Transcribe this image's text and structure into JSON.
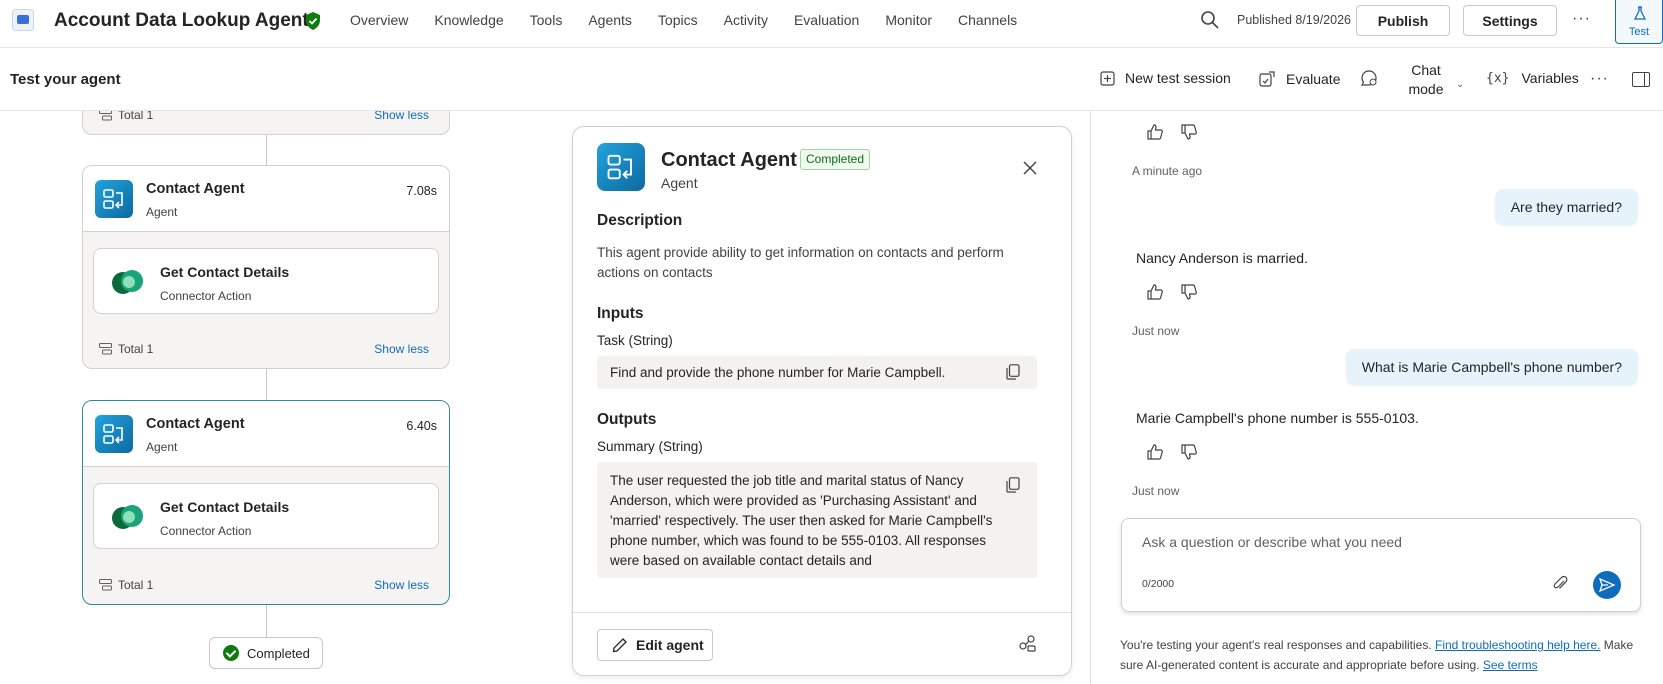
{
  "header": {
    "agent_title": "Account Data Lookup Agent",
    "nav": [
      "Overview",
      "Knowledge",
      "Tools",
      "Agents",
      "Topics",
      "Activity",
      "Evaluation",
      "Monitor",
      "Channels"
    ],
    "published": "Published 8/19/2026",
    "publish_label": "Publish",
    "settings_label": "Settings",
    "more_label": "···",
    "test_tab_label": "Test"
  },
  "subbar": {
    "title": "Test your agent",
    "new_session_label": "New test session",
    "evaluate_label": "Evaluate",
    "chat_mode_line1": "Chat",
    "chat_mode_line2": "mode",
    "variables_label": "Variables",
    "more_label": "···"
  },
  "canvas": {
    "top_partial": {
      "total": "Total 1",
      "show_less": "Show less"
    },
    "cards": [
      {
        "title": "Contact Agent",
        "subtitle": "Agent",
        "time": "7.08s",
        "action_title": "Get Contact Details",
        "action_subtitle": "Connector Action",
        "total": "Total 1",
        "show_less": "Show less"
      },
      {
        "title": "Contact Agent",
        "subtitle": "Agent",
        "time": "6.40s",
        "action_title": "Get Contact Details",
        "action_subtitle": "Connector Action",
        "total": "Total 1",
        "show_less": "Show less"
      }
    ],
    "completed_label": "Completed"
  },
  "detail": {
    "title": "Contact Agent",
    "badge": "Completed",
    "subtitle": "Agent",
    "description_heading": "Description",
    "description": "This agent provide ability to get information on contacts and perform actions on contacts",
    "inputs_heading": "Inputs",
    "input_label": "Task (String)",
    "input_value": "Find and provide the phone number for Marie Campbell.",
    "outputs_heading": "Outputs",
    "output_label": "Summary (String)",
    "output_value": "The user requested the job title and marital status of Nancy Anderson, which were provided as 'Purchasing Assistant' and 'married' respectively. The user then asked for Marie Campbell's phone number, which was found to be 555-0103. All responses were based on available contact details and",
    "output_partial_line": "...",
    "edit_label": "Edit agent"
  },
  "chat": {
    "ts1": "A minute ago",
    "user1": "Are they married?",
    "bot1": "Nancy Anderson is married.",
    "ts2": "Just now",
    "user2": "What is Marie Campbell's phone number?",
    "bot2": "Marie Campbell's phone number is 555-0103.",
    "ts3": "Just now",
    "input_placeholder": "Ask a question or describe what you need",
    "counter": "0/2000",
    "disclaimer_pre": "You're testing your agent's real responses and capabilities. ",
    "disclaimer_link1": "Find troubleshooting help here.",
    "disclaimer_mid": " Make sure AI-generated content is accurate and appropriate before using. ",
    "disclaimer_link2": "See terms"
  },
  "colors": {
    "accent": "#0f6cbd",
    "success": "#0e7a0d",
    "selected_border": "#2a8aa8",
    "agent_icon": "#1a8fce"
  }
}
